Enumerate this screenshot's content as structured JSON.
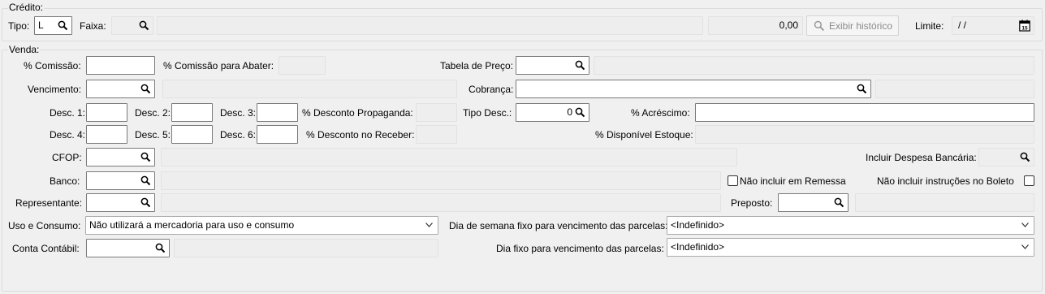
{
  "credito": {
    "legend": "Crédito:",
    "tipo_label": "Tipo:",
    "tipo_value": "L",
    "faixa_label": "Faixa:",
    "amount": "0,00",
    "historico_button": "Exibir histórico",
    "limite_label": "Limite:",
    "limite_value": "/ /"
  },
  "venda": {
    "legend": "Venda:",
    "comissao_label": "% Comissão:",
    "comissao_abater_label": "% Comissão para Abater:",
    "tabela_preco_label": "Tabela de Preço:",
    "vencimento_label": "Vencimento:",
    "cobranca_label": "Cobrança:",
    "desc1_label": "Desc. 1:",
    "desc2_label": "Desc. 2:",
    "desc3_label": "Desc. 3:",
    "desconto_propaganda_label": "% Desconto Propaganda:",
    "tipo_desc_label": "Tipo Desc.:",
    "tipo_desc_value": "0",
    "acrescimo_label": "% Acréscimo:",
    "desc4_label": "Desc. 4:",
    "desc5_label": "Desc. 5:",
    "desc6_label": "Desc. 6:",
    "desconto_receber_label": "% Desconto no Receber:",
    "disponivel_estoque_label": "% Disponível Estoque:",
    "cfop_label": "CFOP:",
    "incluir_despesa_label": "Incluir Despesa Bancária:",
    "banco_label": "Banco:",
    "nao_incluir_remessa_label": "Não incluir em Remessa",
    "nao_incluir_instrucoes_label": "Não incluir instruções no Boleto",
    "representante_label": "Representante:",
    "preposto_label": "Preposto:",
    "uso_consumo_label": "Uso e Consumo:",
    "uso_consumo_value": "Não utilizará a mercadoria para uso e consumo",
    "dia_semana_label": "Dia de semana fixo para vencimento das parcelas:",
    "dia_semana_value": "<Indefinido>",
    "conta_contabil_label": "Conta Contábil:",
    "dia_fixo_label": "Dia fixo para vencimento das parcelas:",
    "dia_fixo_value": "<Indefinido>"
  },
  "icons": {
    "lookup": "magnifier-icon",
    "dropdown": "chevron-down-icon",
    "calendar": "calendar-icon"
  }
}
